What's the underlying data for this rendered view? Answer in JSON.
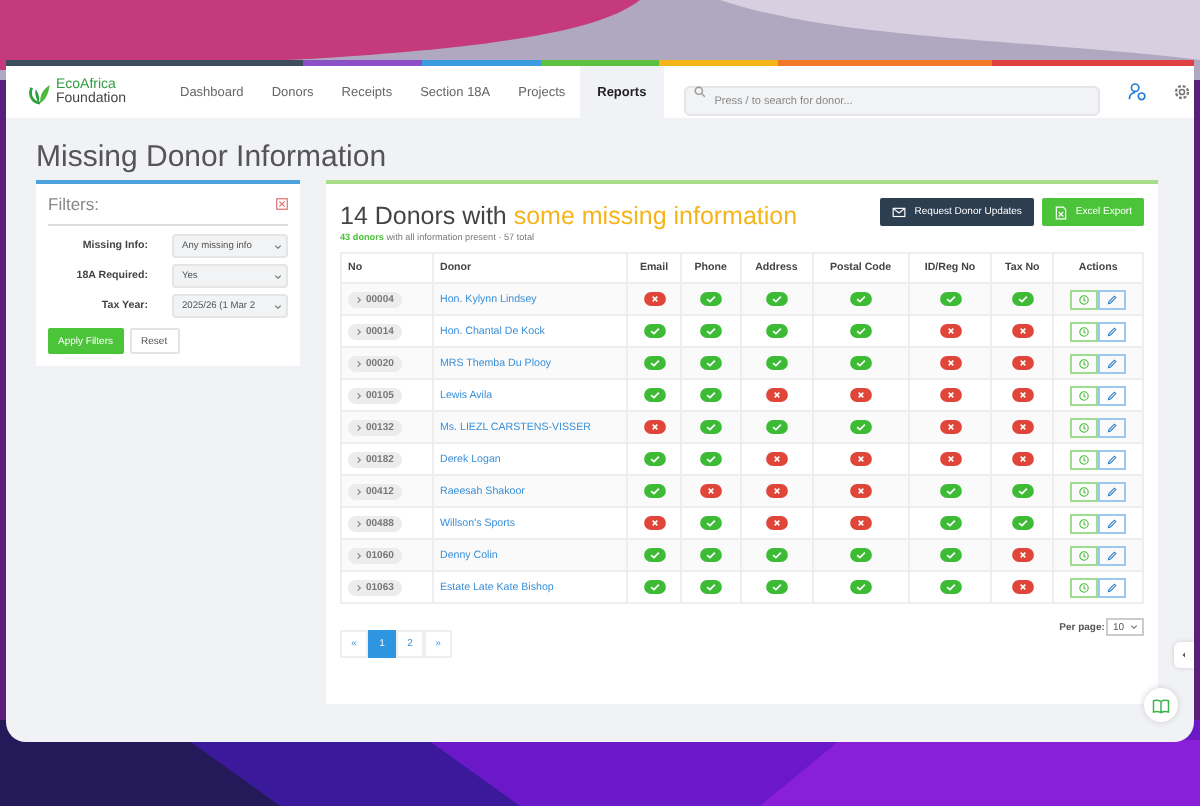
{
  "app": {
    "logo_line1": "EcoAfrica",
    "logo_line2": "Foundation"
  },
  "nav": [
    {
      "label": "Dashboard",
      "selected": false
    },
    {
      "label": "Donors",
      "selected": false
    },
    {
      "label": "Receipts",
      "selected": false
    },
    {
      "label": "Section 18A",
      "selected": false
    },
    {
      "label": "Projects",
      "selected": false
    },
    {
      "label": "Reports",
      "selected": true
    }
  ],
  "search": {
    "placeholder": "Press / to search for donor..."
  },
  "page_title": "Missing Donor Information",
  "filters": {
    "title": "Filters:",
    "fields": [
      {
        "label": "Missing Info:",
        "value": "Any missing info"
      },
      {
        "label": "18A Required:",
        "value": "Yes"
      },
      {
        "label": "Tax Year:",
        "value": "2025/26 (1 Mar 2"
      }
    ],
    "buttons": [
      {
        "label": "Apply Filters",
        "kind": "primary"
      },
      {
        "label": "Reset",
        "kind": "plain"
      }
    ]
  },
  "summary": {
    "heading": "14 Donors with",
    "highlight": "some missing information",
    "subtitle": "**43 donors** with all information present · 57 total"
  },
  "actions": [
    {
      "label": "Request Donor Updates",
      "kind": "dark"
    },
    {
      "label": "Excel Export",
      "kind": "excel"
    }
  ],
  "table": {
    "columns": [
      "No",
      "Donor",
      "Email",
      "Phone",
      "Address",
      "Postal Code",
      "ID/Reg No",
      "Tax No",
      "Actions"
    ],
    "rows": [
      {
        "no": "00004",
        "donor": "Hon. Kylynn Lindsey",
        "checks": [
          false,
          true,
          true,
          true,
          true,
          true
        ]
      },
      {
        "no": "00014",
        "donor": "Hon. Chantal De Kock",
        "checks": [
          true,
          true,
          true,
          true,
          false,
          false
        ]
      },
      {
        "no": "00020",
        "donor": "MRS Themba Du Plooy",
        "checks": [
          true,
          true,
          true,
          true,
          false,
          false
        ]
      },
      {
        "no": "00105",
        "donor": "Lewis Avila",
        "checks": [
          true,
          true,
          false,
          false,
          false,
          false
        ]
      },
      {
        "no": "00132",
        "donor": "Ms. LIEZL CARSTENS-VISSER",
        "checks": [
          false,
          true,
          true,
          true,
          false,
          false
        ]
      },
      {
        "no": "00182",
        "donor": "Derek Logan",
        "checks": [
          true,
          true,
          false,
          false,
          false,
          false
        ]
      },
      {
        "no": "00412",
        "donor": "Raeesah Shakoor",
        "checks": [
          true,
          false,
          false,
          false,
          true,
          true
        ]
      },
      {
        "no": "00488",
        "donor": "Willson's Sports",
        "checks": [
          false,
          true,
          false,
          false,
          true,
          true
        ]
      },
      {
        "no": "01060",
        "donor": "Denny Colin",
        "checks": [
          true,
          true,
          true,
          true,
          true,
          false
        ]
      },
      {
        "no": "01063",
        "donor": "Estate Late Kate Bishop",
        "checks": [
          true,
          true,
          true,
          true,
          true,
          false
        ]
      }
    ]
  },
  "pagination": {
    "prev": "«",
    "pages": [
      {
        "label": "1",
        "selected": true
      },
      {
        "label": "2",
        "selected": false
      }
    ],
    "next": "»"
  },
  "per_page": {
    "label": "Per page:",
    "value": "10"
  }
}
